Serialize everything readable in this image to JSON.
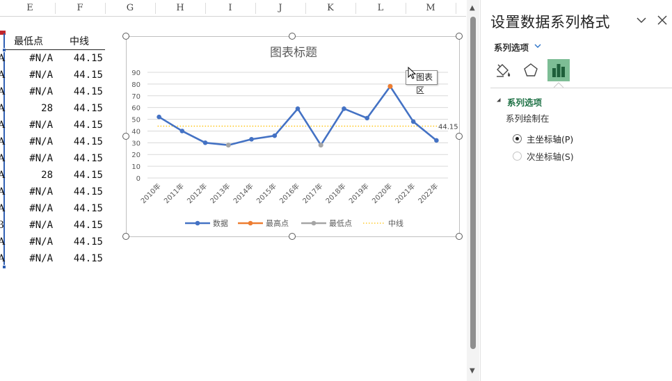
{
  "sheet": {
    "columns": [
      "E",
      "F",
      "G",
      "H",
      "I",
      "J",
      "K",
      "L",
      "M"
    ],
    "headers": {
      "lowest": "最低点",
      "midline": "中线"
    },
    "left_edge_chars": [
      "A",
      "A",
      "A",
      "A",
      "A",
      "A",
      "A",
      "A",
      "A",
      "A",
      "3",
      "A",
      "A"
    ],
    "lowest_values": [
      "#N/A",
      "#N/A",
      "#N/A",
      "28",
      "#N/A",
      "#N/A",
      "#N/A",
      "28",
      "#N/A",
      "#N/A",
      "#N/A",
      "#N/A",
      "#N/A"
    ],
    "midline_values": [
      "44.15",
      "44.15",
      "44.15",
      "44.15",
      "44.15",
      "44.15",
      "44.15",
      "44.15",
      "44.15",
      "44.15",
      "44.15",
      "44.15",
      "44.15"
    ]
  },
  "chart_data": {
    "type": "line",
    "title": "图表标题",
    "categories": [
      "2010年",
      "2011年",
      "2012年",
      "2013年",
      "2014年",
      "2015年",
      "2016年",
      "2017年",
      "2018年",
      "2019年",
      "2020年",
      "2021年",
      "2022年"
    ],
    "ylim": [
      0,
      90
    ],
    "yticks": [
      "0",
      "10",
      "20",
      "30",
      "40",
      "50",
      "60",
      "70",
      "80",
      "90"
    ],
    "grid": true,
    "legend_position": "bottom",
    "series": [
      {
        "name": "数据",
        "color": "#4472c4",
        "values": [
          52,
          40,
          30,
          28,
          33,
          36,
          59,
          28,
          59,
          51,
          78,
          48,
          32
        ]
      },
      {
        "name": "最高点",
        "color": "#ed7d31",
        "values": [
          null,
          null,
          null,
          null,
          null,
          null,
          null,
          null,
          null,
          null,
          78,
          null,
          null
        ]
      },
      {
        "name": "最低点",
        "color": "#a5a5a5",
        "values": [
          null,
          null,
          null,
          28,
          null,
          null,
          null,
          28,
          null,
          null,
          null,
          null,
          null
        ]
      },
      {
        "name": "中线",
        "color": "#ffc000",
        "style": "dotted",
        "values": [
          44.15,
          44.15,
          44.15,
          44.15,
          44.15,
          44.15,
          44.15,
          44.15,
          44.15,
          44.15,
          44.15,
          44.15,
          44.15
        ]
      }
    ],
    "annotations": [
      {
        "text": "44.15",
        "series": "中线"
      }
    ]
  },
  "tooltip": {
    "text": "图表区"
  },
  "pane": {
    "title": "设置数据系列格式",
    "options_dropdown": "系列选项",
    "tabs": [
      {
        "name": "fill-line",
        "icon": "paint-bucket-icon"
      },
      {
        "name": "effects",
        "icon": "pentagon-icon"
      },
      {
        "name": "series-options",
        "icon": "bar-chart-icon"
      }
    ],
    "section_title": "系列选项",
    "plot_on_label": "系列绘制在",
    "primary_axis": "主坐标轴(P)",
    "secondary_axis": "次坐标轴(S)"
  },
  "colors": {
    "accent_green": "#1e7145",
    "selected_tab": "#7dbd95",
    "selection_blue": "#2f5fb3"
  }
}
